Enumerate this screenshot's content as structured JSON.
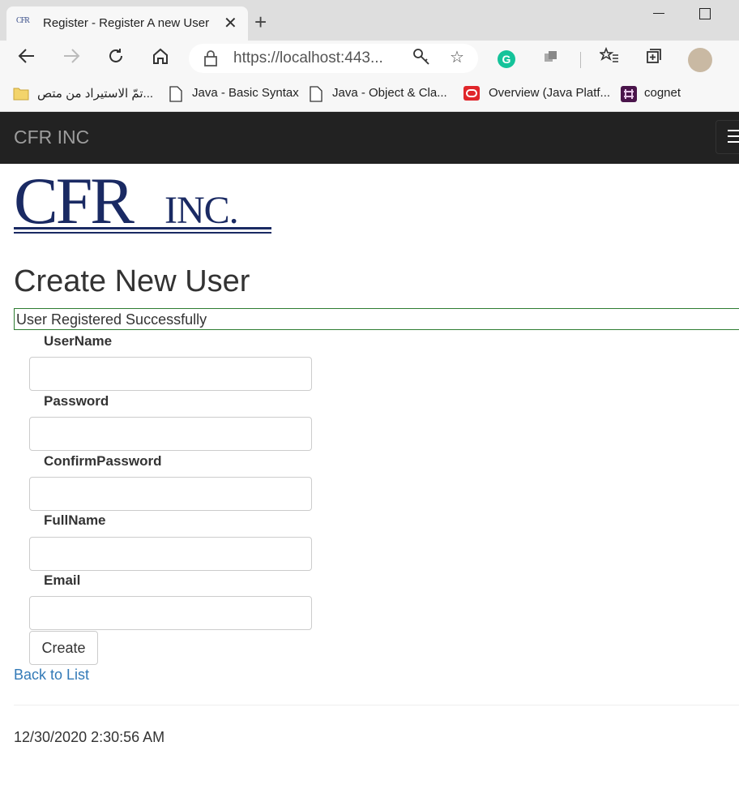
{
  "browser": {
    "tab_title": "Register - Register A new User",
    "tab_favicon_text": "CFR INC",
    "url": "https://localhost:443...",
    "bookmarks": [
      {
        "label": "تمّ الاستيراد من متص...",
        "icon": "folder-icon"
      },
      {
        "label": "Java - Basic Syntax",
        "icon": "page-icon"
      },
      {
        "label": "Java - Object & Cla...",
        "icon": "page-icon"
      },
      {
        "label": "Overview (Java Platf...",
        "icon": "oracle-icon"
      },
      {
        "label": "cognet",
        "icon": "slack-icon"
      }
    ]
  },
  "app": {
    "brand": "CFR INC",
    "logo_text": "CFR INC.",
    "page_title": "Create New User",
    "status_message": "User Registered Successfully",
    "status_color": "#2e7d32",
    "fields": [
      {
        "label": "UserName",
        "value": ""
      },
      {
        "label": "Password",
        "value": ""
      },
      {
        "label": "ConfirmPassword",
        "value": ""
      },
      {
        "label": "FullName",
        "value": ""
      },
      {
        "label": "Email",
        "value": ""
      }
    ],
    "create_button": "Create",
    "back_link": "Back to List",
    "footer_timestamp": "12/30/2020 2:30:56 AM",
    "link_color": "#337ab7",
    "navbar_color": "#222222"
  }
}
